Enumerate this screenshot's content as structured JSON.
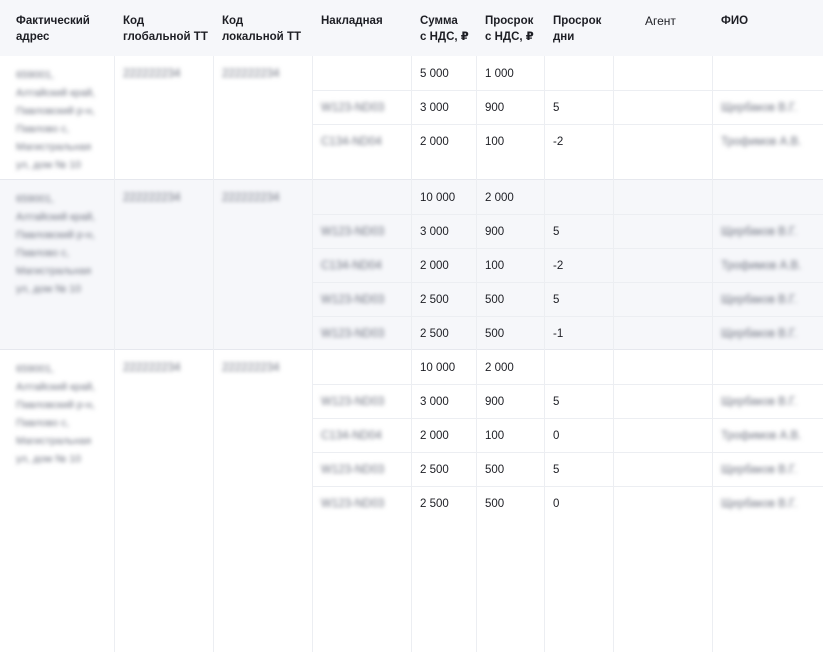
{
  "columns": [
    {
      "key": "address",
      "label": "Фактический\nадрес"
    },
    {
      "key": "global_code",
      "label": "Код\nглобальной ТТ"
    },
    {
      "key": "local_code",
      "label": "Код\nлокальной ТТ"
    },
    {
      "key": "invoice",
      "label": "Накладная"
    },
    {
      "key": "sum_vat",
      "label": "Сумма\nс НДС, ₽"
    },
    {
      "key": "overdue_vat",
      "label": "Просрок\nс НДС, ₽"
    },
    {
      "key": "overdue_days",
      "label": "Просрок\nдни"
    },
    {
      "key": "agent",
      "label": "Агент"
    },
    {
      "key": "fio",
      "label": "ФИО"
    }
  ],
  "groups": [
    {
      "address": "659001,\nАлтайский край,\nПавловский р-н,\nПавлово с,\nМагистральная\nул, дом № 10",
      "global_code": "222222234",
      "local_code": "222222234",
      "rows": [
        {
          "invoice": "",
          "sum": "5 000",
          "overdue": "1 000",
          "days": "",
          "fio": ""
        },
        {
          "invoice": "W123-ND03",
          "sum": "3 000",
          "overdue": "900",
          "days": "5",
          "fio": "Щербаков В.Г."
        },
        {
          "invoice": "C134-ND04",
          "sum": "2 000",
          "overdue": "100",
          "days": "-2",
          "fio": "Трофимов А.В."
        }
      ]
    },
    {
      "address": "659001,\nАлтайский край,\nПавловский р-н,\nПавлово с,\nМагистральная\nул, дом № 10",
      "global_code": "222222234",
      "local_code": "222222234",
      "rows": [
        {
          "invoice": "",
          "sum": "10 000",
          "overdue": "2 000",
          "days": "",
          "fio": ""
        },
        {
          "invoice": "W123-ND03",
          "sum": "3 000",
          "overdue": "900",
          "days": "5",
          "fio": "Щербаков В.Г."
        },
        {
          "invoice": "C134-ND04",
          "sum": "2 000",
          "overdue": "100",
          "days": "-2",
          "fio": "Трофимов А.В."
        },
        {
          "invoice": "W123-ND03",
          "sum": "2 500",
          "overdue": "500",
          "days": "5",
          "fio": "Щербаков В.Г."
        },
        {
          "invoice": "W123-ND03",
          "sum": "2 500",
          "overdue": "500",
          "days": "-1",
          "fio": "Щербаков В.Г."
        }
      ]
    },
    {
      "address": "659001,\nАлтайский край,\nПавловский р-н,\nПавлово с,\nМагистральная\nул, дом № 10",
      "global_code": "222222234",
      "local_code": "222222234",
      "rows": [
        {
          "invoice": "",
          "sum": "10 000",
          "overdue": "2 000",
          "days": "",
          "fio": ""
        },
        {
          "invoice": "W123-ND03",
          "sum": "3 000",
          "overdue": "900",
          "days": "5",
          "fio": "Щербаков В.Г."
        },
        {
          "invoice": "C134-ND04",
          "sum": "2 000",
          "overdue": "100",
          "days": "0",
          "fio": "Трофимов А.В."
        },
        {
          "invoice": "W123-ND03",
          "sum": "2 500",
          "overdue": "500",
          "days": "5",
          "fio": "Щербаков В.Г."
        },
        {
          "invoice": "W123-ND03",
          "sum": "2 500",
          "overdue": "500",
          "days": "0",
          "fio": "Щербаков В.Г."
        }
      ]
    }
  ]
}
